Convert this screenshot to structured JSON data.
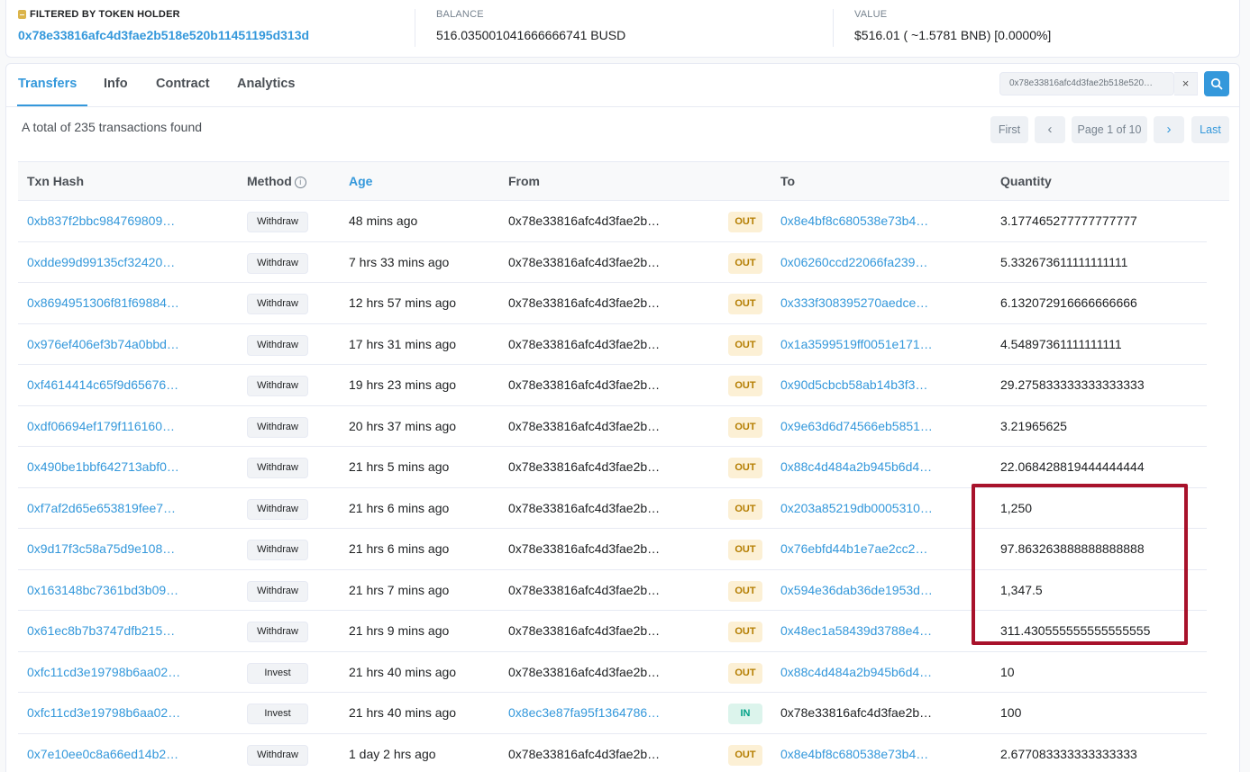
{
  "summary": {
    "filter_label": "FILTERED BY TOKEN HOLDER",
    "filter_address": "0x78e33816afc4d3fae2b518e520b11451195d313d",
    "balance_label": "BALANCE",
    "balance_value": "516.035001041666666741 BUSD",
    "value_label": "VALUE",
    "value_value": "$516.01 ( ~1.5781 BNB) [0.0000%]"
  },
  "tabs": [
    "Transfers",
    "Info",
    "Contract",
    "Analytics"
  ],
  "search": {
    "value": "0x78e33816afc4d3fae2b518e520…",
    "clear": "×"
  },
  "total_text": "A total of 235 transactions found",
  "pager": {
    "first": "First",
    "prev": "‹",
    "page": "Page 1 of 10",
    "next": "›",
    "last": "Last"
  },
  "columns": {
    "hash": "Txn Hash",
    "method": "Method",
    "age": "Age",
    "from": "From",
    "to": "To",
    "qty": "Quantity"
  },
  "rows": [
    {
      "hash": "0xb837f2bbc984769809…",
      "method": "Withdraw",
      "age": "48 mins ago",
      "from": "0x78e33816afc4d3fae2b…",
      "dir": "OUT",
      "to": "0x8e4bf8c680538e73b4…",
      "qty": "3.177465277777777777"
    },
    {
      "hash": "0xdde99d99135cf32420…",
      "method": "Withdraw",
      "age": "7 hrs 33 mins ago",
      "from": "0x78e33816afc4d3fae2b…",
      "dir": "OUT",
      "to": "0x06260ccd22066fa239…",
      "qty": "5.332673611111111111"
    },
    {
      "hash": "0x8694951306f81f69884…",
      "method": "Withdraw",
      "age": "12 hrs 57 mins ago",
      "from": "0x78e33816afc4d3fae2b…",
      "dir": "OUT",
      "to": "0x333f308395270aedce…",
      "qty": "6.132072916666666666"
    },
    {
      "hash": "0x976ef406ef3b74a0bbd…",
      "method": "Withdraw",
      "age": "17 hrs 31 mins ago",
      "from": "0x78e33816afc4d3fae2b…",
      "dir": "OUT",
      "to": "0x1a3599519ff0051e171…",
      "qty": "4.54897361111111111"
    },
    {
      "hash": "0xf4614414c65f9d65676…",
      "method": "Withdraw",
      "age": "19 hrs 23 mins ago",
      "from": "0x78e33816afc4d3fae2b…",
      "dir": "OUT",
      "to": "0x90d5cbcb58ab14b3f3…",
      "qty": "29.275833333333333333"
    },
    {
      "hash": "0xdf06694ef179f116160…",
      "method": "Withdraw",
      "age": "20 hrs 37 mins ago",
      "from": "0x78e33816afc4d3fae2b…",
      "dir": "OUT",
      "to": "0x9e63d6d74566eb5851…",
      "qty": "3.21965625"
    },
    {
      "hash": "0x490be1bbf642713abf0…",
      "method": "Withdraw",
      "age": "21 hrs 5 mins ago",
      "from": "0x78e33816afc4d3fae2b…",
      "dir": "OUT",
      "to": "0x88c4d484a2b945b6d4…",
      "qty": "22.068428819444444444"
    },
    {
      "hash": "0xf7af2d65e653819fee7…",
      "method": "Withdraw",
      "age": "21 hrs 6 mins ago",
      "from": "0x78e33816afc4d3fae2b…",
      "dir": "OUT",
      "to": "0x203a85219db0005310…",
      "qty": "1,250"
    },
    {
      "hash": "0x9d17f3c58a75d9e108…",
      "method": "Withdraw",
      "age": "21 hrs 6 mins ago",
      "from": "0x78e33816afc4d3fae2b…",
      "dir": "OUT",
      "to": "0x76ebfd44b1e7ae2cc2…",
      "qty": "97.863263888888888888"
    },
    {
      "hash": "0x163148bc7361bd3b09…",
      "method": "Withdraw",
      "age": "21 hrs 7 mins ago",
      "from": "0x78e33816afc4d3fae2b…",
      "dir": "OUT",
      "to": "0x594e36dab36de1953d…",
      "qty": "1,347.5"
    },
    {
      "hash": "0x61ec8b7b3747dfb215…",
      "method": "Withdraw",
      "age": "21 hrs 9 mins ago",
      "from": "0x78e33816afc4d3fae2b…",
      "dir": "OUT",
      "to": "0x48ec1a58439d3788e4…",
      "qty": "311.430555555555555555"
    },
    {
      "hash": "0xfc11cd3e19798b6aa02…",
      "method": "Invest",
      "age": "21 hrs 40 mins ago",
      "from": "0x78e33816afc4d3fae2b…",
      "dir": "OUT",
      "to": "0x88c4d484a2b945b6d4…",
      "qty": "10"
    },
    {
      "hash": "0xfc11cd3e19798b6aa02…",
      "method": "Invest",
      "age": "21 hrs 40 mins ago",
      "from": "0x8ec3e87fa95f1364786…",
      "dir": "IN",
      "to": "0x78e33816afc4d3fae2b…",
      "qty": "100"
    },
    {
      "hash": "0x7e10ee0c8a66ed14b2…",
      "method": "Withdraw",
      "age": "1 day 2 hrs ago",
      "from": "0x78e33816afc4d3fae2b…",
      "dir": "OUT",
      "to": "0x8e4bf8c680538e73b4…",
      "qty": "2.677083333333333333"
    }
  ]
}
